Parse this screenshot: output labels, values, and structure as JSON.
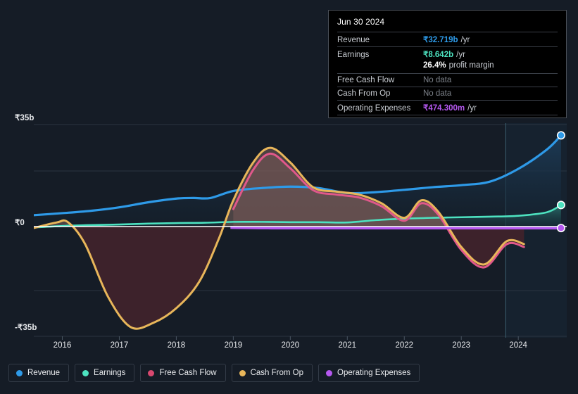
{
  "chart_data": {
    "type": "area",
    "title": "",
    "xlabel": "",
    "ylabel": "",
    "currency_symbol": "₹",
    "x_tick_labels": [
      "2016",
      "2017",
      "2018",
      "2019",
      "2020",
      "2021",
      "2022",
      "2023",
      "2024"
    ],
    "y_tick_labels": [
      "₹35b",
      "₹0",
      "-₹35b"
    ],
    "ylim": [
      -35,
      35
    ],
    "y_unit": "b",
    "grid": true,
    "legend_position": "bottom-left",
    "forecast_divider_x_label": "2023.8",
    "series": [
      {
        "name": "Revenue",
        "color": "#2e9ae8",
        "fill": "#1b3a55",
        "endpoint_value": 32.719,
        "x": [
          2015.5,
          2016.0,
          2016.5,
          2017.0,
          2017.5,
          2018.0,
          2018.3,
          2018.6,
          2019.0,
          2019.5,
          2020.0,
          2020.5,
          2021.0,
          2021.5,
          2022.0,
          2022.5,
          2023.0,
          2023.5,
          2024.0,
          2024.5,
          2024.75
        ],
        "values": [
          3.9,
          4.6,
          5.4,
          6.6,
          8.3,
          9.6,
          9.8,
          9.8,
          12.2,
          13.2,
          13.7,
          13.2,
          11.5,
          11.8,
          12.6,
          13.5,
          14.2,
          15.4,
          19.8,
          26.4,
          31.3
        ]
      },
      {
        "name": "Earnings",
        "color": "#4de2c0",
        "fill": "#1d4a4c",
        "endpoint_value": 8.642,
        "x": [
          2015.5,
          2016.0,
          2016.5,
          2017.0,
          2017.5,
          2018.0,
          2018.5,
          2019.0,
          2019.5,
          2020.0,
          2020.5,
          2021.0,
          2021.5,
          2022.0,
          2022.5,
          2023.0,
          2023.5,
          2024.0,
          2024.5,
          2024.75
        ],
        "values": [
          -0.3,
          0.2,
          0.5,
          0.7,
          1.0,
          1.2,
          1.3,
          1.6,
          1.6,
          1.5,
          1.5,
          1.4,
          2.2,
          2.7,
          3.0,
          3.2,
          3.4,
          3.7,
          4.9,
          7.4
        ]
      },
      {
        "name": "Free Cash Flow",
        "color": "#e0588a",
        "fill": "#3d222b",
        "endpoint_value": null,
        "x": [
          2019.0,
          2019.35,
          2019.65,
          2020.0,
          2020.4,
          2020.8,
          2021.2,
          2021.6,
          2022.0,
          2022.3,
          2022.6,
          2023.0,
          2023.4,
          2023.8,
          2024.1
        ],
        "values": [
          6.0,
          19.5,
          25.0,
          20.0,
          12.5,
          11.0,
          10.0,
          7.0,
          2.0,
          8.0,
          4.0,
          -8.0,
          -14.0,
          -6.0,
          -7.0
        ]
      },
      {
        "name": "Cash From Op",
        "color": "#e8b65a",
        "fill": "#3d222b",
        "endpoint_value": null,
        "x": [
          2015.5,
          2015.9,
          2016.1,
          2016.4,
          2016.8,
          2017.2,
          2017.6,
          2018.0,
          2018.4,
          2018.75,
          2019.0,
          2019.35,
          2019.65,
          2020.0,
          2020.4,
          2020.8,
          2021.2,
          2021.6,
          2022.0,
          2022.3,
          2022.6,
          2023.0,
          2023.4,
          2023.8,
          2024.1
        ],
        "values": [
          -0.5,
          1.4,
          1.5,
          -6.0,
          -24.0,
          -34.5,
          -33.0,
          -28.0,
          -19.0,
          -4.0,
          9.0,
          22.0,
          27.0,
          22.0,
          13.5,
          12.0,
          11.0,
          8.0,
          3.0,
          9.0,
          5.0,
          -7.0,
          -13.0,
          -5.0,
          -6.0
        ]
      },
      {
        "name": "Operating Expenses",
        "color": "#b558f0",
        "fill": "none",
        "endpoint_value": 0.4743,
        "x": [
          2018.95,
          2019.5,
          2020.0,
          2021.0,
          2022.0,
          2023.0,
          2024.0,
          2024.75
        ],
        "values": [
          -0.3,
          -0.45,
          -0.5,
          -0.5,
          -0.5,
          -0.5,
          -0.5,
          -0.5
        ]
      }
    ]
  },
  "tooltip": {
    "date": "Jun 30 2024",
    "rows": [
      {
        "label": "Revenue",
        "value": "₹32.719b",
        "unit": "/yr",
        "color": "#2e9ae8",
        "no_data": false
      },
      {
        "label": "Earnings",
        "value": "₹8.642b",
        "unit": "/yr",
        "color": "#4de2c0",
        "no_data": false
      },
      {
        "label": "Free Cash Flow",
        "value": "No data",
        "unit": "",
        "color": "#7c8189",
        "no_data": true
      },
      {
        "label": "Cash From Op",
        "value": "No data",
        "unit": "",
        "color": "#7c8189",
        "no_data": true
      },
      {
        "label": "Operating Expenses",
        "value": "₹474.300m",
        "unit": "/yr",
        "color": "#b558f0",
        "no_data": false
      }
    ],
    "profit_margin_value": "26.4%",
    "profit_margin_label": "profit margin"
  },
  "legend": {
    "items": [
      {
        "label": "Revenue",
        "color": "#2e9ae8"
      },
      {
        "label": "Earnings",
        "color": "#4de2c0"
      },
      {
        "label": "Free Cash Flow",
        "color": "#d9486f"
      },
      {
        "label": "Cash From Op",
        "color": "#e8b65a"
      },
      {
        "label": "Operating Expenses",
        "color": "#b558f0"
      }
    ]
  },
  "axes": {
    "y_top": "₹35b",
    "y_zero": "₹0",
    "y_bottom": "-₹35b",
    "x_ticks": [
      "2016",
      "2017",
      "2018",
      "2019",
      "2020",
      "2021",
      "2022",
      "2023",
      "2024"
    ]
  }
}
